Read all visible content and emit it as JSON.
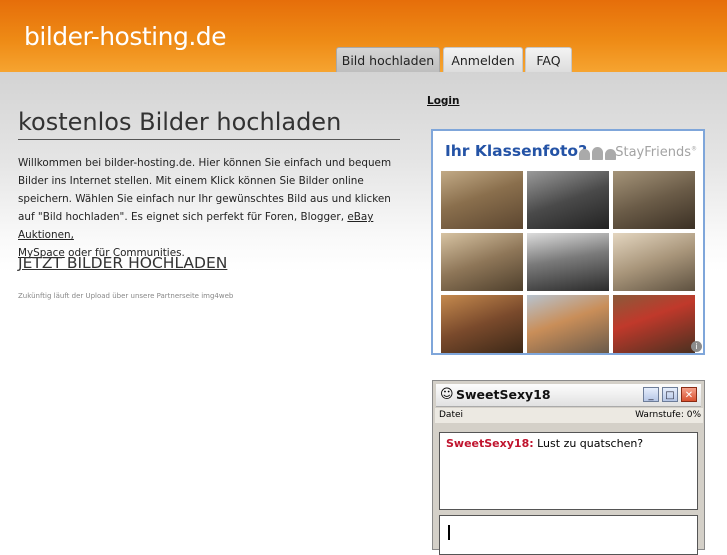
{
  "header": {
    "logo": "bilder-hosting.de",
    "tabs": [
      {
        "label": "Bild hochladen",
        "active": true
      },
      {
        "label": "Anmelden",
        "active": false
      },
      {
        "label": "FAQ",
        "active": false
      }
    ]
  },
  "main": {
    "title": "kostenlos Bilder hochladen",
    "intro_text": "Willkommen bei bilder-hosting.de. Hier können Sie einfach und bequem Bilder ins Internet stellen. Mit einem Klick können Sie Bilder online speichern. Wählen Sie einfach nur Ihr gewünschtes Bild aus und klicken auf \"Bild hochladen\". Es eignet sich perfekt für Foren, Blogger, ",
    "link_ebay": "eBay Auktionen,",
    "link_myspace": "MySpace",
    "intro_end": " oder für Communities.",
    "cta": "JETZT BILDER HOCHLADEN",
    "note": "Zukünftig läuft der Upload über unsere Partnerseite img4web"
  },
  "sidebar": {
    "login": "Login",
    "ad": {
      "headline": "Ihr Klassenfoto?",
      "brand": "StayFriends",
      "brand_mark": "®",
      "info_icon": "info-icon",
      "accent_color": "#2453a6",
      "border_color": "#7fa6da"
    },
    "chat": {
      "title": "SweetSexy18",
      "icon": "messenger-person-icon",
      "buttons": {
        "minimize": "_",
        "maximize": "□",
        "close": "✕"
      },
      "menu_file": "Datei",
      "warn_level": "Warnstufe: 0%",
      "message_user": "SweetSexy18:",
      "message_text": " Lust zu quatschen?",
      "input_value": ""
    }
  },
  "colors": {
    "header_orange": "#ee8a15",
    "chat_name_red": "#c0142e"
  }
}
